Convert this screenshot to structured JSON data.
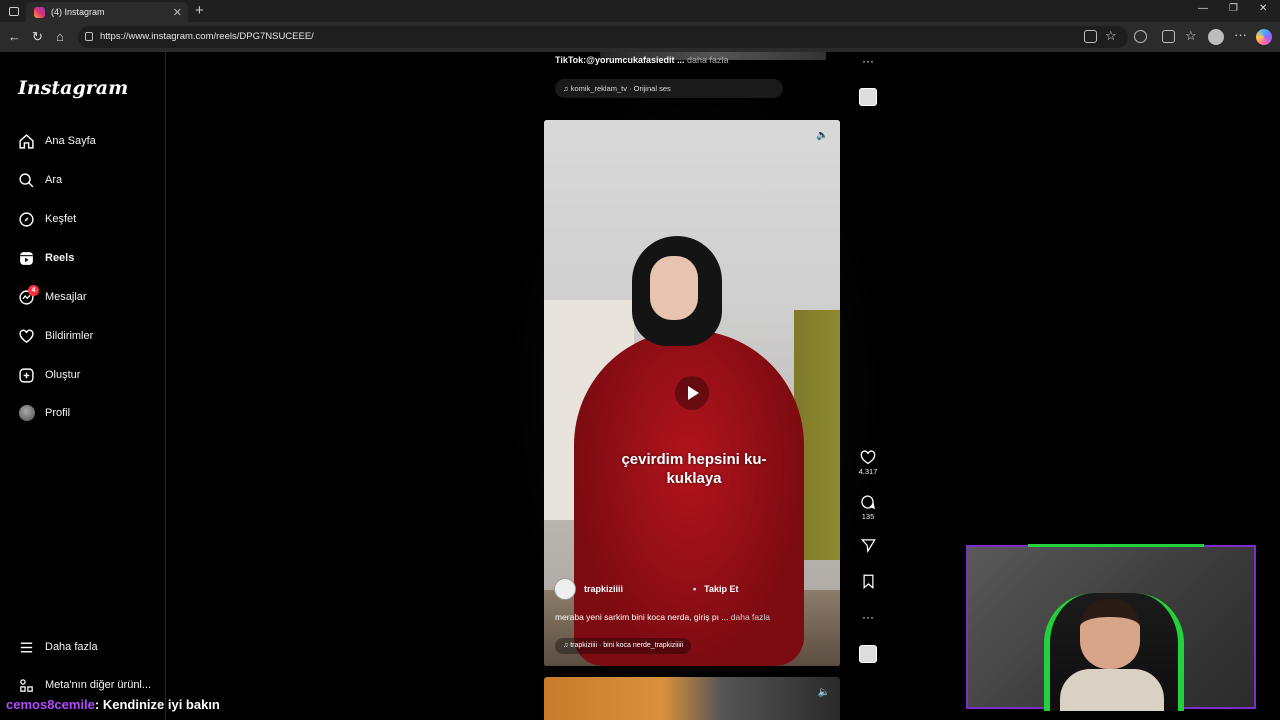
{
  "browser": {
    "tab_title": "(4) Instagram",
    "url": "https://www.instagram.com/reels/DPG7NSUCEEE/"
  },
  "sidebar": {
    "logo": "Instagram",
    "items": [
      {
        "label": "Ana Sayfa",
        "icon": "home-icon"
      },
      {
        "label": "Ara",
        "icon": "search-icon"
      },
      {
        "label": "Keşfet",
        "icon": "compass-icon"
      },
      {
        "label": "Reels",
        "icon": "reels-icon"
      },
      {
        "label": "Mesajlar",
        "icon": "messenger-icon",
        "badge": "4"
      },
      {
        "label": "Bildirimler",
        "icon": "heart-icon"
      },
      {
        "label": "Oluştur",
        "icon": "plus-square-icon"
      },
      {
        "label": "Profil",
        "icon": "avatar"
      }
    ],
    "more_label": "Daha fazla",
    "meta_label": "Meta'nın diğer ürünl..."
  },
  "prev_reel": {
    "caption": "TikTok:@yorumcukafasiedit ...",
    "caption_more": "daha fazla",
    "audio": "komik_reklam_tv · Orijinal ses"
  },
  "reel": {
    "overlay_text": "çevirdim hepsini ku- kuklaya",
    "username": "trapkiziiii",
    "follow_label": "Takip Et",
    "caption": "meraba yeni sarkim bini koca nerda, giriş pı ...",
    "caption_more": "daha fazla",
    "audio": "trapkiziiii · bini koca nerde_trapkiziiiii",
    "likes": "4.317",
    "comments": "135"
  },
  "chat": {
    "user": "cemos8cemile",
    "message": ": Kendinize iyi bakın"
  },
  "colors": {
    "accent_badge": "#ff3040",
    "cam_border": "#7a30c8",
    "cam_chair_green": "#23d13a"
  }
}
